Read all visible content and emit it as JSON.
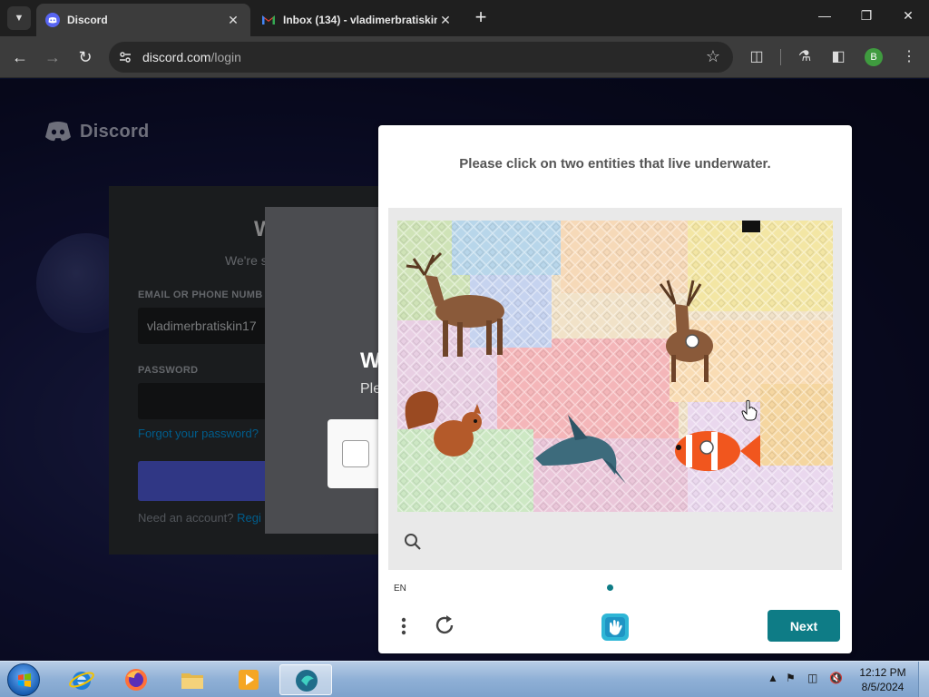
{
  "browser": {
    "tabs": [
      {
        "title": "Discord",
        "active": true,
        "favicon": "discord-icon"
      },
      {
        "title": "Inbox (134) - vladimerbratiskin",
        "active": false,
        "favicon": "gmail-icon"
      }
    ],
    "url_host": "discord.com",
    "url_path": "/login",
    "profile_initial": "B"
  },
  "page": {
    "brand": "Discord",
    "login": {
      "heading": "W",
      "subheading": "We're s",
      "email_label": "EMAIL OR PHONE NUMB",
      "email_value": "vladimerbratiskin17",
      "password_label": "PASSWORD",
      "forgot": "Forgot your password?",
      "register_prefix": "Need an account?",
      "register_link": "Regi"
    },
    "captcha_modal": {
      "title": "W",
      "subtitle": "Ple"
    }
  },
  "challenge": {
    "prompt": "Please click on two entities that live underwater.",
    "language": "EN",
    "next_label": "Next",
    "entities": [
      "deer",
      "deer",
      "squirrel",
      "shark",
      "clownfish"
    ],
    "selected_count": 2
  },
  "taskbar": {
    "time": "12:12 PM",
    "date": "8/5/2024",
    "apps": [
      "internet-explorer-icon",
      "firefox-icon",
      "file-explorer-icon",
      "media-player-icon",
      "app-icon"
    ]
  },
  "colors": {
    "accent": "#0e7c86",
    "discord_blurple": "#5865f2"
  }
}
